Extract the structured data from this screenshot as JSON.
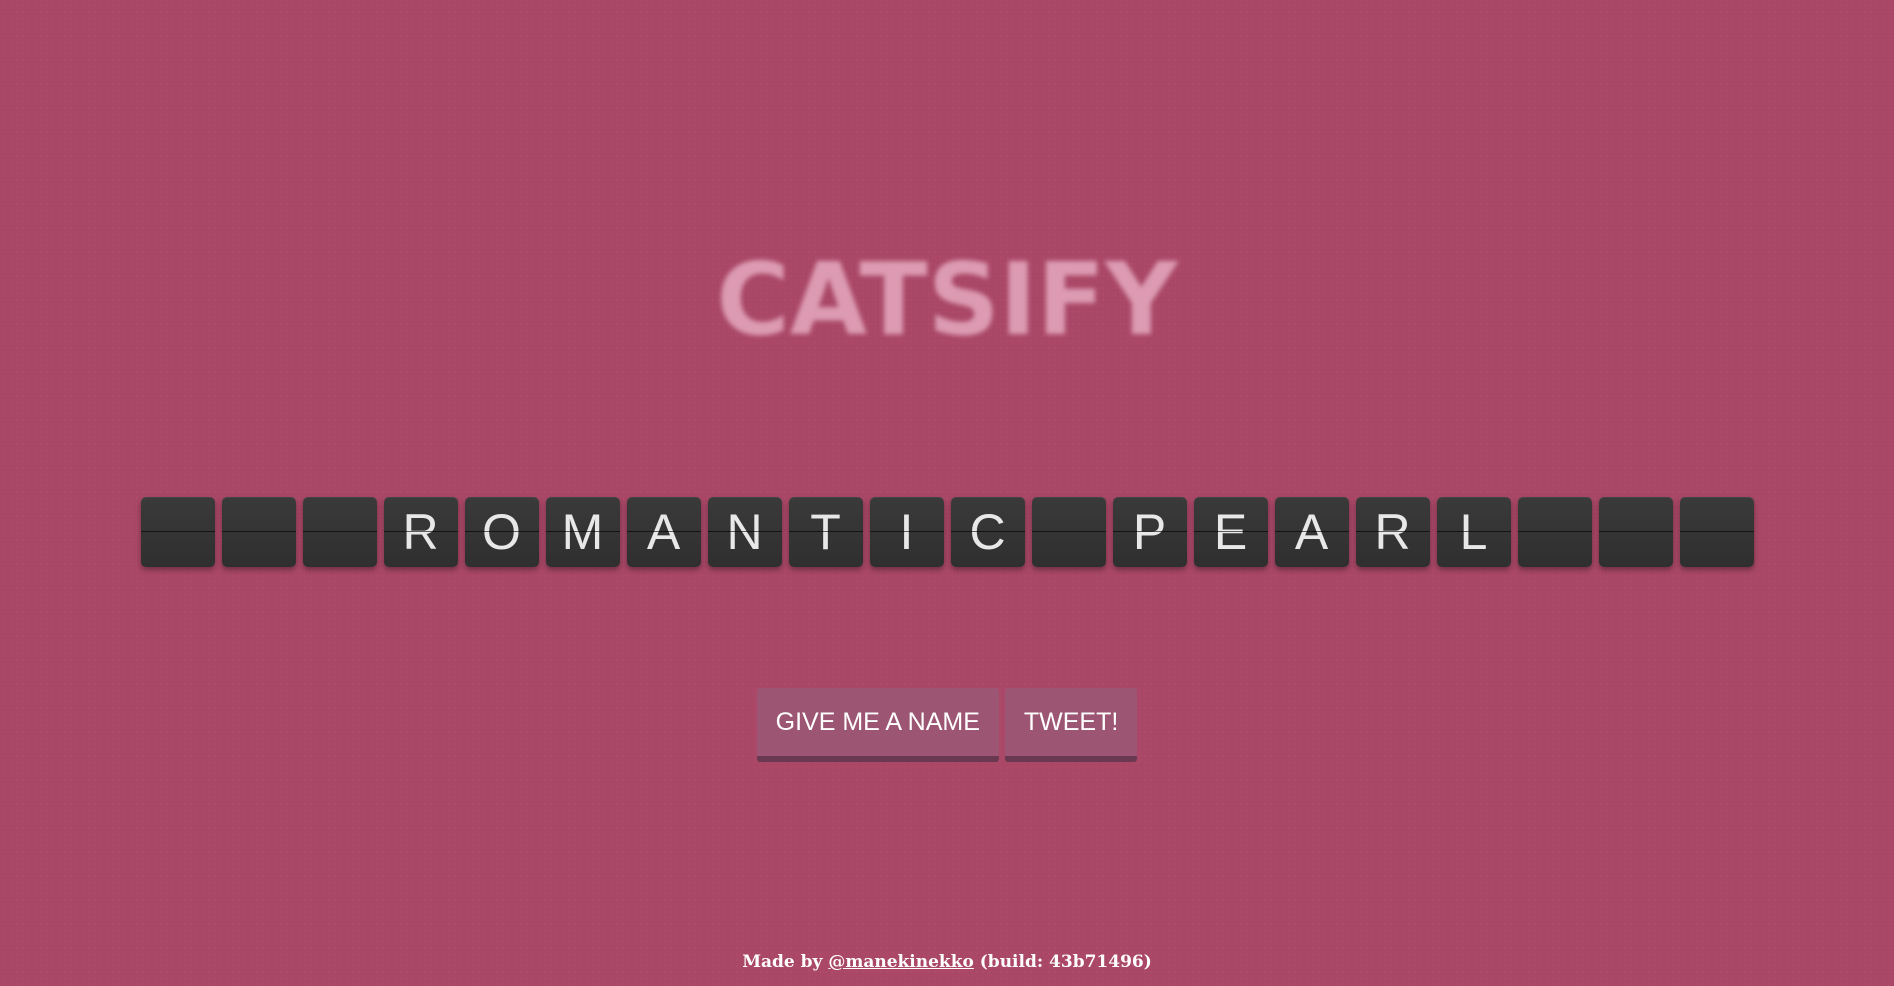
{
  "logo": {
    "text": "CATSIFY"
  },
  "board": {
    "tiles": [
      "",
      "",
      "",
      "R",
      "O",
      "M",
      "A",
      "N",
      "T",
      "I",
      "C",
      "",
      "P",
      "E",
      "A",
      "R",
      "L",
      "",
      "",
      ""
    ]
  },
  "actions": {
    "give_name_label": "GIVE ME A NAME",
    "tweet_label": "TWEET!"
  },
  "footer": {
    "prefix": "Made by ",
    "author": "@manekinekko",
    "suffix": " (build: 43b71496)"
  },
  "colors": {
    "background": "#ab4868",
    "tile": "#333333",
    "button": "#9c5673"
  }
}
